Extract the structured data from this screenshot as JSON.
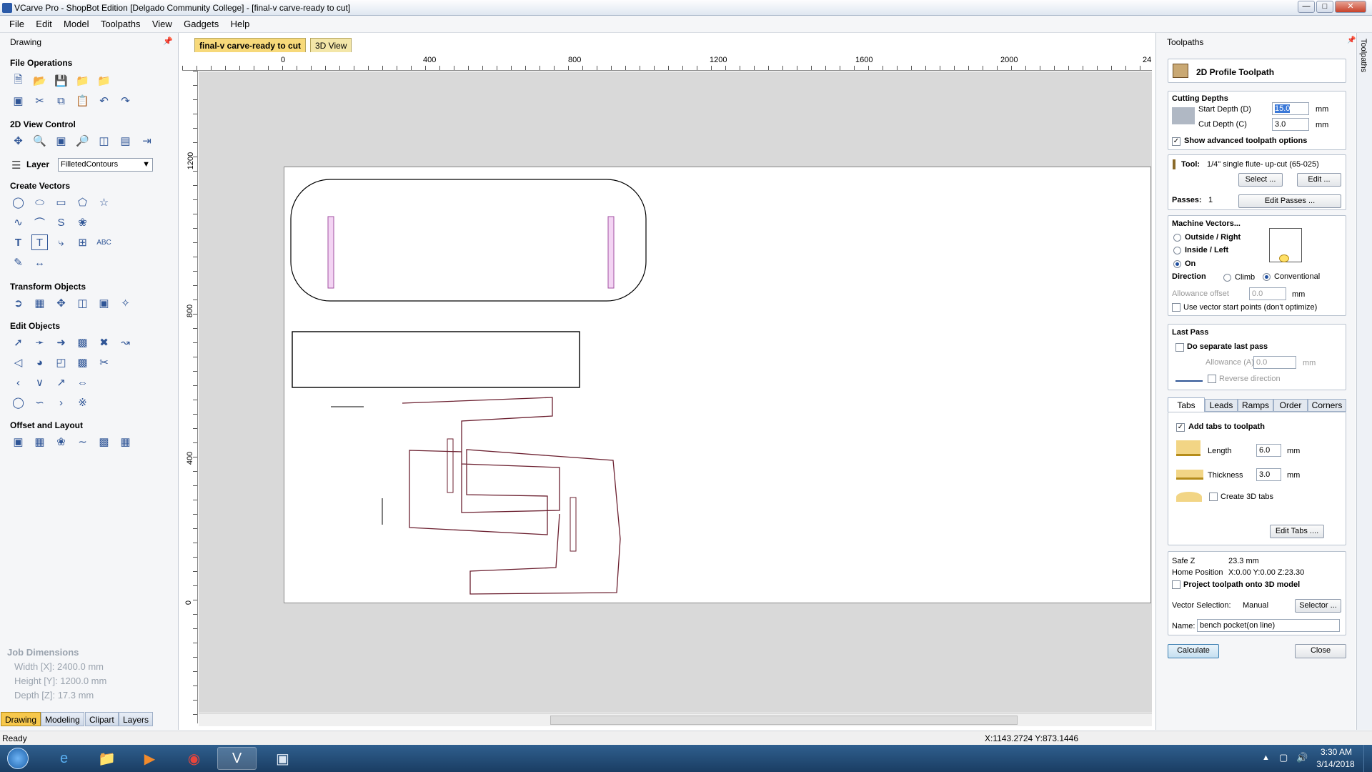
{
  "window": {
    "title": "VCarve Pro - ShopBot Edition [Delgado Community College] - [final-v carve-ready to cut]"
  },
  "menu": [
    "File",
    "Edit",
    "Model",
    "Toolpaths",
    "View",
    "Gadgets",
    "Help"
  ],
  "left_panel": {
    "header": "Drawing",
    "sections": {
      "file_ops": "File Operations",
      "view_control": "2D View Control",
      "create_vectors": "Create Vectors",
      "transform": "Transform Objects",
      "edit_objects": "Edit Objects",
      "offset_layout": "Offset and Layout"
    },
    "layer_label": "Layer",
    "layer_value": "FilletedContours",
    "job_dimensions": {
      "title": "Job Dimensions",
      "width": "Width  [X]: 2400.0 mm",
      "height": "Height [Y]: 1200.0 mm",
      "depth": "Depth  [Z]: 17.3 mm"
    },
    "bottom_tabs": [
      "Drawing",
      "Modeling",
      "Clipart",
      "Layers"
    ]
  },
  "doc_tabs": {
    "active": "final-v carve-ready to cut",
    "other": "3D View"
  },
  "ruler": {
    "top_labels": [
      "0",
      "400",
      "800",
      "1200",
      "1600",
      "2000",
      "24"
    ],
    "left_labels": [
      "1200",
      "800",
      "400",
      "0"
    ]
  },
  "status": {
    "left": "Ready",
    "coords": "X:1143.2724 Y:873.1446"
  },
  "right_panel": {
    "header": "Toolpaths",
    "strip": "Toolpaths",
    "toolpath_title": "2D Profile Toolpath",
    "cutting_depths": {
      "title": "Cutting Depths",
      "start_label": "Start Depth (D)",
      "start_value": "15.0",
      "cut_label": "Cut Depth (C)",
      "cut_value": "3.0",
      "unit": "mm",
      "advanced": "Show advanced toolpath options"
    },
    "tool": {
      "label": "Tool:",
      "name": "1/4\" single flute- up-cut (65-025)",
      "select_btn": "Select ...",
      "edit_btn": "Edit ...",
      "passes_label": "Passes:",
      "passes_value": "1",
      "edit_passes_btn": "Edit Passes ..."
    },
    "machine_vectors": {
      "title": "Machine Vectors...",
      "outside": "Outside / Right",
      "inside": "Inside / Left",
      "on": "On",
      "direction_label": "Direction",
      "climb": "Climb",
      "conventional": "Conventional",
      "allowance_label": "Allowance offset",
      "allowance_value": "0.0",
      "unit": "mm",
      "start_points": "Use vector start points (don't optimize)"
    },
    "last_pass": {
      "title": "Last Pass",
      "separate": "Do separate last pass",
      "allowance_label": "Allowance (A)",
      "allowance_value": "0.0",
      "unit": "mm",
      "reverse": "Reverse direction"
    },
    "tabs": [
      "Tabs",
      "Leads",
      "Ramps",
      "Order",
      "Corners"
    ],
    "tabs_panel": {
      "add_tabs": "Add tabs to toolpath",
      "length_label": "Length",
      "length_value": "6.0",
      "thickness_label": "Thickness",
      "thickness_value": "3.0",
      "unit": "mm",
      "create_3d": "Create 3D tabs",
      "edit_tabs_btn": "Edit Tabs ...."
    },
    "safe_z_label": "Safe Z",
    "safe_z_value": "23.3 mm",
    "home_label": "Home Position",
    "home_value": "X:0.00 Y:0.00 Z:23.30",
    "project": "Project toolpath onto 3D model",
    "vector_sel_label": "Vector Selection:",
    "vector_sel_value": "Manual",
    "selector_btn": "Selector ...",
    "name_label": "Name:",
    "name_value": "bench pocket(on line)",
    "calculate_btn": "Calculate",
    "close_btn": "Close"
  },
  "taskbar": {
    "time": "3:30 AM",
    "date": "3/14/2018"
  }
}
